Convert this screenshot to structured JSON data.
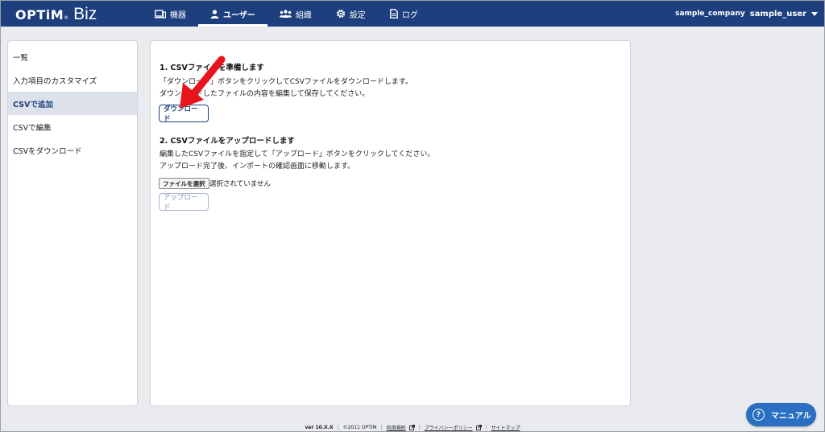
{
  "header": {
    "logo_main": "OPTiM",
    "logo_reg": "®",
    "logo_sub": "Biz",
    "nav": [
      {
        "label": "機器",
        "icon": "device-icon"
      },
      {
        "label": "ユーザー",
        "icon": "user-icon"
      },
      {
        "label": "組織",
        "icon": "organization-icon"
      },
      {
        "label": "設定",
        "icon": "gear-icon"
      },
      {
        "label": "ログ",
        "icon": "log-icon"
      }
    ],
    "active_nav": "ユーザー",
    "company": "sample_company",
    "username": "sample_user"
  },
  "sidebar": {
    "items": [
      {
        "label": "一覧"
      },
      {
        "label": "入力項目のカスタマイズ"
      },
      {
        "label": "CSVで追加"
      },
      {
        "label": "CSVで編集"
      },
      {
        "label": "CSVをダウンロード"
      }
    ],
    "active": "CSVで追加"
  },
  "main": {
    "step1": {
      "title": "1. CSVファイルを準備します",
      "line1": "「ダウンロード」ボタンをクリックしてCSVファイルをダウンロードします。",
      "line2": "ダウンロードしたファイルの内容を編集して保存してください。",
      "button": "ダウンロード"
    },
    "step2": {
      "title": "2. CSVファイルをアップロードします",
      "line1": "編集したCSVファイルを指定して「アップロード」ボタンをクリックしてください。",
      "line2": "アップロード完了後、インポートの確認画面に移動します。",
      "file_button": "ファイルを選択",
      "file_status": "選択されていません",
      "upload_button": "アップロード"
    }
  },
  "footer": {
    "version": "ver 10.X.X",
    "copyright": "©2011 OPTiM",
    "terms": "利用規約",
    "privacy": "プライバシーポリシー",
    "sitemap": "サイトマップ",
    "separator": "|"
  },
  "manual_button": "マニュアル",
  "colors": {
    "header_bg": "#1d3f7e",
    "accent": "#1d3f7e",
    "manual_bg": "#2a6fc1",
    "annotation_arrow": "#e8141b"
  }
}
